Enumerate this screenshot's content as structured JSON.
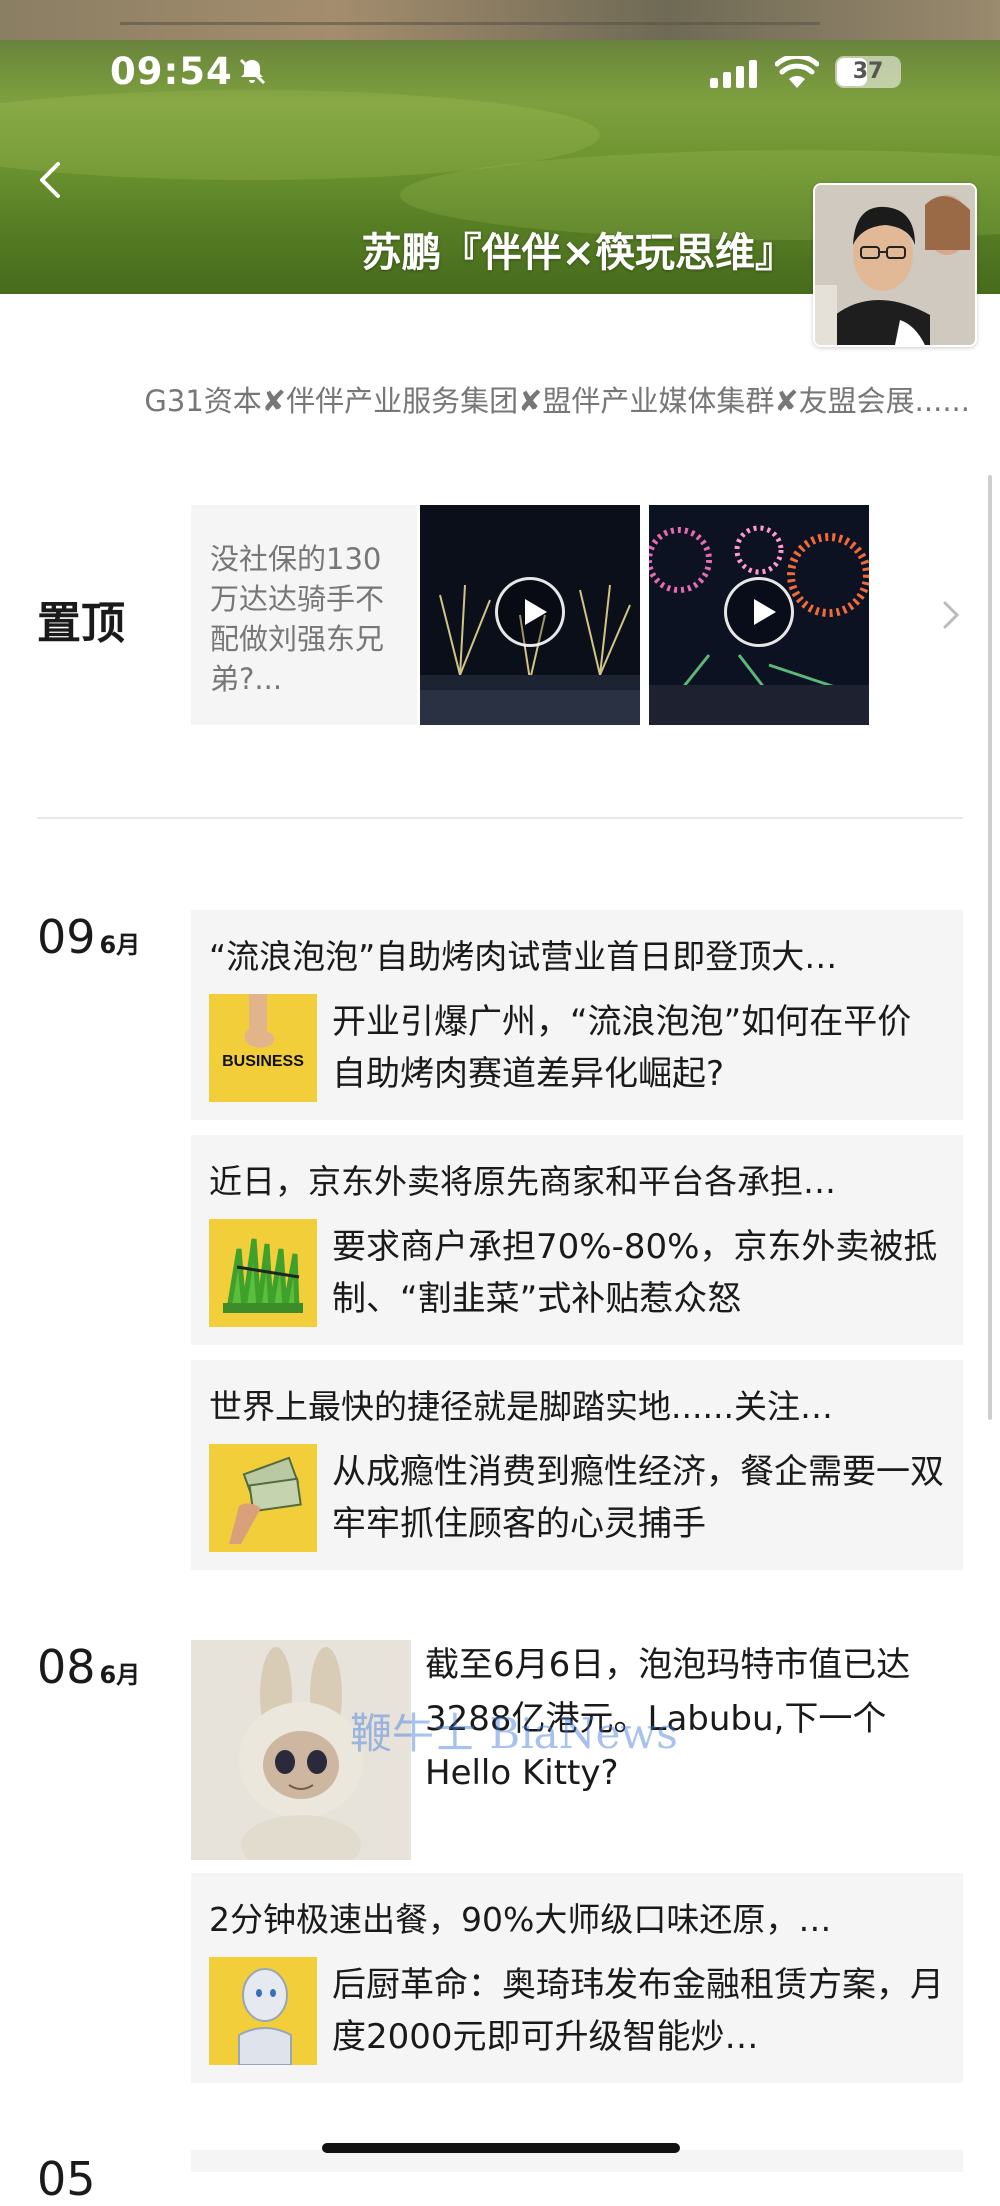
{
  "status_bar": {
    "time": "09:54",
    "battery": "37"
  },
  "header": {
    "title": "苏鹏『伴伴×筷玩思维』",
    "subtitle": "G31资本✘伴伴产业服务集团✘盟伴产业媒体集群✘友盟会展......"
  },
  "pinned": {
    "label": "置顶",
    "text": "没社保的130万达达骑手不配做刘强东兄弟?..."
  },
  "days": [
    {
      "day": "09",
      "month": "6月"
    },
    {
      "day": "08",
      "month": "6月"
    },
    {
      "day": "05",
      "month": ""
    }
  ],
  "posts": [
    {
      "head": "“流浪泡泡”自助烤肉试营业首日即登顶大…",
      "body": "开业引爆广州，“流浪泡泡”如何在平价自助烤肉赛道差异化崛起?",
      "thumb_text": "BUSINESS"
    },
    {
      "head": "近日，京东外卖将原先商家和平台各承担…",
      "body": "要求商户承担70%-80%，京东外卖被抵制、“割韭菜”式补贴惹众怒"
    },
    {
      "head": "世界上最快的捷径就是脚踏实地......关注…",
      "body": "从成瘾性消费到瘾性经济，餐企需要一双牢牢抓住顾客的心灵捕手"
    },
    {
      "body": "截至6月6日，泡泡玛特市值已达3288亿港元。Labubu,下一个Hello Kitty?",
      "watermark": "鞭牛士 BiaNews"
    },
    {
      "head": "2分钟极速出餐，90%大师级口味还原，…",
      "body": "后厨革命：奥琦玮发布金融租赁方案，月度2000元即可升级智能炒…"
    }
  ]
}
